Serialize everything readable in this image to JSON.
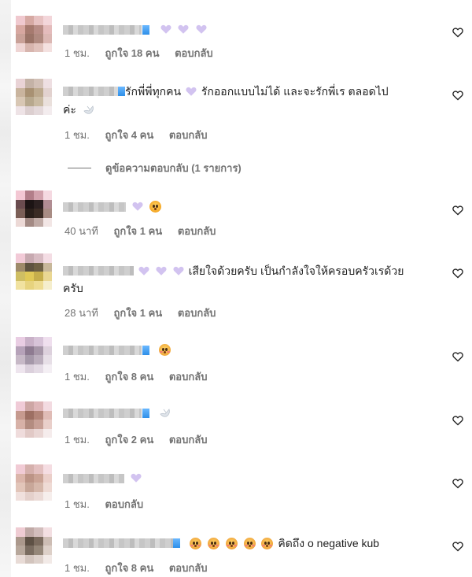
{
  "comments": [
    {
      "text": "",
      "time": "1 ชม.",
      "likes": "ถูกใจ 18 คน",
      "reply": "ตอบกลับ"
    },
    {
      "text": "รักพี่พี่ทุกคน",
      "text2": "รักออกแบบไม่ได้ และจะรักพี่เร ตลอดไป",
      "text3": "ค่ะ",
      "time": "1 ชม.",
      "likes": "ถูกใจ 4 คน",
      "reply": "ตอบกลับ",
      "view_replies": "ดูข้อความตอบกลับ (1 รายการ)"
    },
    {
      "text": "",
      "time": "40 นาที",
      "likes": "ถูกใจ 1 คน",
      "reply": "ตอบกลับ"
    },
    {
      "text": "เสียใจด้วยครับ เป็นกำลังใจให้ครอบครัวเรด้วย",
      "text2": "ครับ",
      "time": "28 นาที",
      "likes": "ถูกใจ 1 คน",
      "reply": "ตอบกลับ"
    },
    {
      "text": "",
      "time": "1 ชม.",
      "likes": "ถูกใจ 8 คน",
      "reply": "ตอบกลับ"
    },
    {
      "text": "",
      "time": "1 ชม.",
      "likes": "ถูกใจ 2 คน",
      "reply": "ตอบกลับ"
    },
    {
      "text": "",
      "time": "1 ชม.",
      "reply": "ตอบกลับ"
    },
    {
      "text": "คิดถึง o negative kub",
      "time": "1 ชม.",
      "likes": "ถูกใจ 8 คน",
      "reply": "ตอบกลับ"
    }
  ],
  "icons": {
    "like": "heart-outline-icon",
    "purple_heart": "purple-heart-emoji",
    "dove": "dove-emoji",
    "shocked": "shocked-face-emoji",
    "flushed": "flushed-face-emoji",
    "pleading": "pleading-face-emoji"
  },
  "colors": {
    "text": "#1f1f1f",
    "meta": "#737373",
    "heart_emoji": "#cdbcf2",
    "verified": "#2f8fe8"
  }
}
